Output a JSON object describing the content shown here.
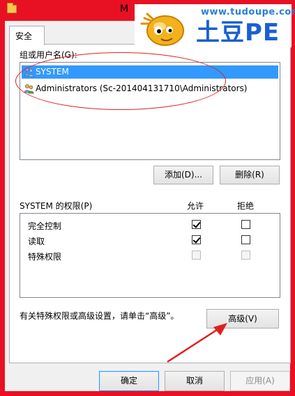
{
  "window": {
    "title_partial": "M"
  },
  "tabs": [
    {
      "label": "安全"
    }
  ],
  "users_section": {
    "label": "组或用户名(G):",
    "users": [
      {
        "name": "SYSTEM",
        "selected": true
      },
      {
        "name": "Administrators (Sc-201404131710\\Administrators)",
        "selected": false
      }
    ],
    "add_button": "添加(D)...",
    "remove_button": "删除(R)"
  },
  "permissions_section": {
    "label": "SYSTEM 的权限(P)",
    "allow_header": "允许",
    "deny_header": "拒绝",
    "rows": [
      {
        "name": "完全控制",
        "allow": true,
        "deny": false,
        "disabled": false
      },
      {
        "name": "读取",
        "allow": true,
        "deny": false,
        "disabled": false
      },
      {
        "name": "特殊权限",
        "allow": false,
        "deny": false,
        "disabled": true
      }
    ]
  },
  "advanced": {
    "note": "有关特殊权限或高级设置，请单击“高级”。",
    "button": "高级(V)"
  },
  "footer": {
    "ok": "确定",
    "cancel": "取消",
    "apply": "应用(A)"
  },
  "watermark": {
    "url": "www.tudoupe.com",
    "brand": "土豆PE"
  },
  "colors": {
    "window_frame": "#e81123",
    "selection": "#3399ff",
    "annotation": "#e02020",
    "watermark_blue": "#1a5fd0"
  }
}
